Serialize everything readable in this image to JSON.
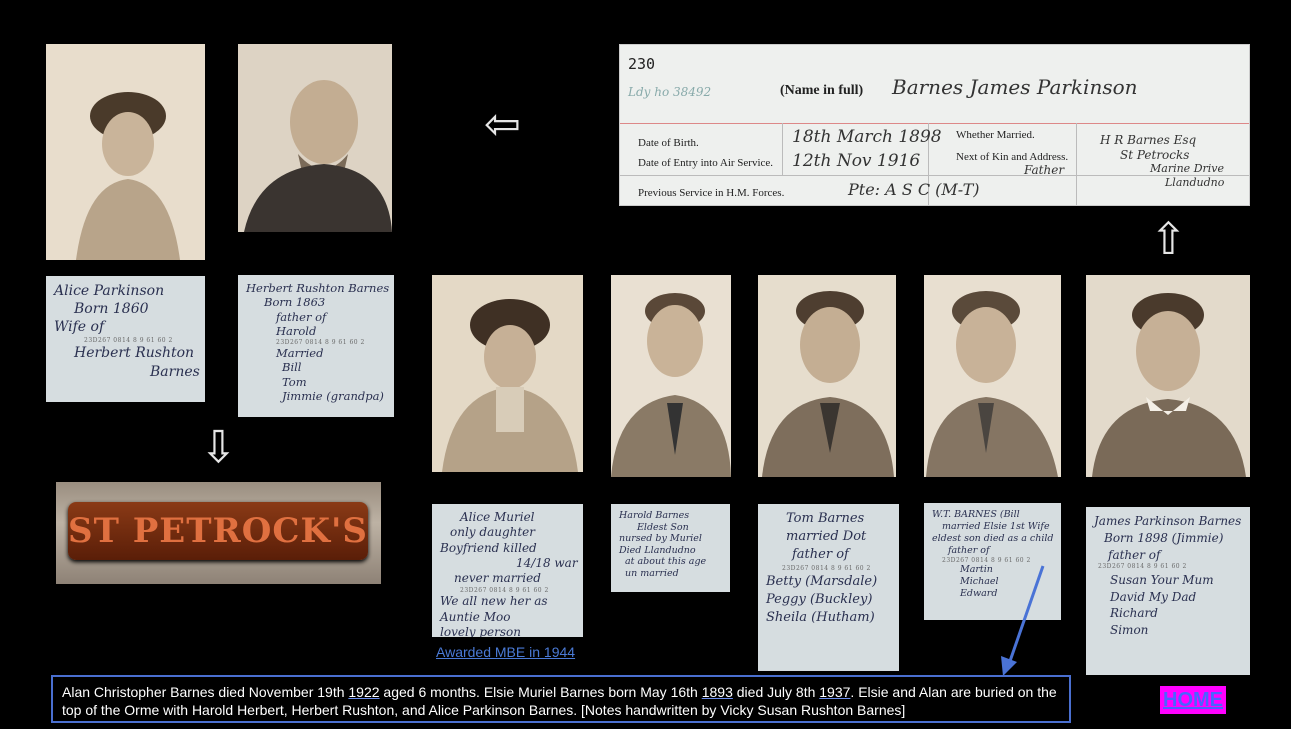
{
  "record": {
    "number": "230",
    "ref": "Ldy ho 38492",
    "name_label": "(Name in full)",
    "name_value": "Barnes James Parkinson",
    "dob_label": "Date of Birth.",
    "dob_value": "18th March 1898",
    "entry_label": "Date of Entry into Air Service.",
    "entry_value": "12th Nov 1916",
    "married_label": "Whether Married.",
    "kin_label": "Next of Kin and Address.",
    "kin_relation": "Father",
    "kin_value_1": "H R Barnes Esq",
    "kin_value_2": "St Petrocks",
    "kin_value_3": "Marine Drive",
    "kin_value_4": "Llandudno",
    "prev_label": "Previous Service in H.M. Forces.",
    "prev_value": "Pte: A S C (M-T)"
  },
  "notes": {
    "alice_parkinson": [
      "Alice Parkinson",
      "Born 1860",
      "Wife of",
      "Herbert Rushton",
      "Barnes"
    ],
    "herbert": [
      "Herbert Rushton Barnes",
      "Born 1863",
      "father of",
      "Harold",
      "Married",
      "Bill",
      "Tom",
      "Jimmie (grandpa)"
    ],
    "alice_muriel": [
      "Alice Muriel",
      "only daughter",
      "Boyfriend killed",
      "14/18 war",
      "never married",
      "We all new her as",
      "Auntie Moo",
      "lovely person"
    ],
    "harold": [
      "Harold Barnes",
      "Eldest Son",
      "nursed by Muriel",
      "Died Llandudno",
      "at about this age",
      "un married"
    ],
    "tom": [
      "Tom Barnes",
      "married Dot",
      "father of",
      "Betty (Marsdale)",
      "Peggy (Buckley)",
      "Sheila (Hutham)"
    ],
    "bill": [
      "W.T. BARNES (Bill",
      "married Elsie 1st Wife",
      "eldest son died as a child",
      "father of",
      "Martin",
      "Michael",
      "Edward"
    ],
    "james": [
      "James Parkinson Barnes",
      "Born 1898 (Jimmie)",
      "father of",
      "Susan Your Mum",
      "David My Dad",
      "Richard",
      "Simon"
    ]
  },
  "stamp_text": "23D267 0814 8 9 61 60 2",
  "sign_text": "ST PETROCK'S",
  "link_mbe": "Awarded MBE in 1944",
  "caption": {
    "part1": "Alan Christopher Barnes died November 19th ",
    "y1": "1922",
    "part2": " aged 6 months. Elsie Muriel Barnes born May 16th ",
    "y2": "1893",
    "part3": " died July 8th ",
    "y3": "1937",
    "part4": ". Elsie and Alan are buried on the top of the Orme with Harold Herbert, Herbert Rushton, and Alice Parkinson Barnes. [Notes handwritten by Vicky Susan Rushton Barnes]"
  },
  "home_label": "HOME",
  "arrows": {
    "left": "⇦",
    "down": "⇩",
    "up": "⇧"
  }
}
